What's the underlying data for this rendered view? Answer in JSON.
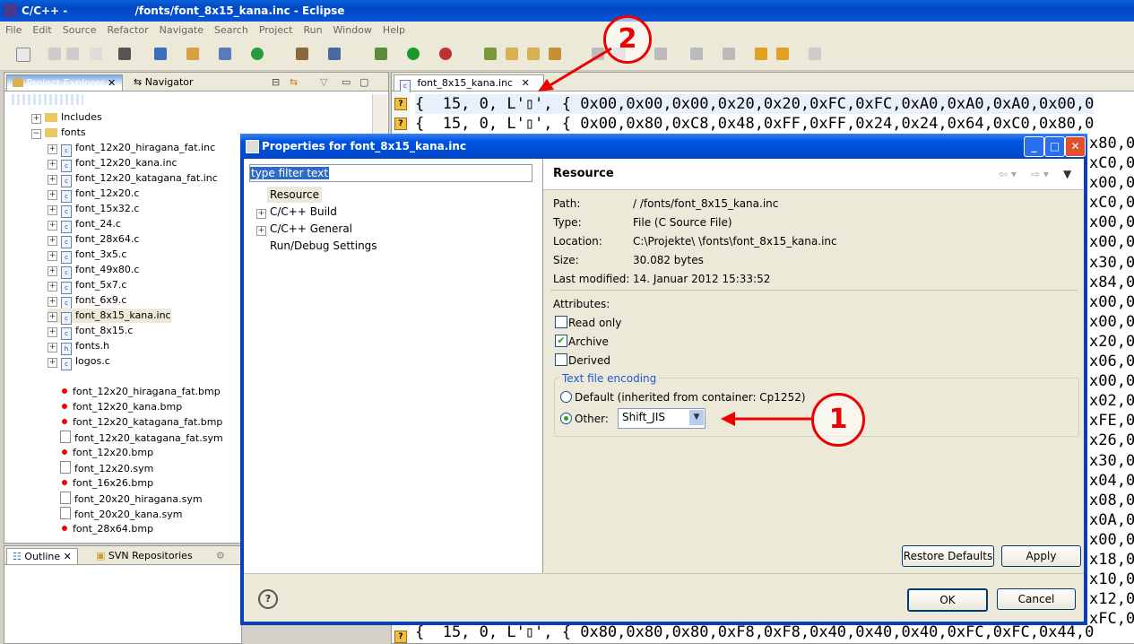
{
  "window": {
    "title": "C/C++ -                  /fonts/font_8x15_kana.inc - Eclipse"
  },
  "menu": [
    "File",
    "Edit",
    "Source",
    "Refactor",
    "Navigate",
    "Search",
    "Project",
    "Run",
    "Window",
    "Help"
  ],
  "explorer": {
    "tabs": [
      "Project Explorer",
      "Navigator"
    ],
    "items": [
      {
        "label": "Includes",
        "icon": "includes-icon"
      },
      {
        "label": "fonts",
        "icon": "folder-icon"
      },
      {
        "label": "font_12x20_hiragana_fat.inc",
        "icon": "c-file-icon"
      },
      {
        "label": "font_12x20_kana.inc",
        "icon": "c-file-icon"
      },
      {
        "label": "font_12x20_katagana_fat.inc",
        "icon": "c-file-icon"
      },
      {
        "label": "font_12x20.c",
        "icon": "c-file-icon"
      },
      {
        "label": "font_15x32.c",
        "icon": "c-file-icon"
      },
      {
        "label": "font_24.c",
        "icon": "c-file-icon"
      },
      {
        "label": "font_28x64.c",
        "icon": "c-file-icon"
      },
      {
        "label": "font_3x5.c",
        "icon": "c-file-icon"
      },
      {
        "label": "font_49x80.c",
        "icon": "c-file-icon"
      },
      {
        "label": "font_5x7.c",
        "icon": "c-file-icon"
      },
      {
        "label": "font_6x9.c",
        "icon": "c-file-icon"
      },
      {
        "label": "font_8x15_kana.inc",
        "icon": "c-file-icon"
      },
      {
        "label": "font_8x15.c",
        "icon": "c-file-icon"
      },
      {
        "label": "fonts.h",
        "icon": "h-file-icon"
      },
      {
        "label": "logos.c",
        "icon": "c-file-icon"
      },
      {
        "label": "",
        "icon": "blank"
      },
      {
        "label": "font_12x20_hiragana_fat.bmp",
        "icon": "bmp-file-icon"
      },
      {
        "label": "font_12x20_kana.bmp",
        "icon": "bmp-file-icon"
      },
      {
        "label": "font_12x20_katagana_fat.bmp",
        "icon": "bmp-file-icon"
      },
      {
        "label": "font_12x20_katagana_fat.sym",
        "icon": "sym-file-icon"
      },
      {
        "label": "font_12x20.bmp",
        "icon": "bmp-file-icon"
      },
      {
        "label": "font_12x20.sym",
        "icon": "sym-file-icon"
      },
      {
        "label": "font_16x26.bmp",
        "icon": "bmp-file-icon"
      },
      {
        "label": "font_20x20_hiragana.sym",
        "icon": "sym-file-icon"
      },
      {
        "label": "font_20x20_kana.sym",
        "icon": "sym-file-icon"
      },
      {
        "label": "font_28x64.bmp",
        "icon": "bmp-file-icon"
      }
    ]
  },
  "bottom_tabs": [
    "Outline",
    "SVN Repositories"
  ],
  "editor": {
    "tab": "font_8x15_kana.inc",
    "line1": "{  15, 0, L'▯', { 0x00,0x00,0x00,0x20,0x20,0xFC,0xFC,0xA0,0xA0,0xA0,0x00,0",
    "line2": "{  15, 0, L'▯', { 0x00,0x80,0xC8,0x48,0xFF,0xFF,0x24,0x24,0x64,0xC0,0x80,0",
    "line_last": "{  15, 0, L'▯', { 0x80,0x80,0x80,0xF8,0xF8,0x40,0x40,0x40,0xFC,0xFC,0x44,0",
    "right_column": [
      "x80,0",
      "xC0,0",
      "x00,0",
      "xC0,0",
      "x00,0",
      "x00,0",
      "x30,0",
      "x84,0",
      "x00,0",
      "x00,0",
      "x20,0",
      "x06,0",
      "x00,0",
      "x02,0",
      "xFE,0",
      "x26,0",
      "x30,0",
      "x04,0",
      "x08,0",
      "x0A,0",
      "x00,0",
      "x18,0",
      "x10,0",
      "x12,0",
      "xFC,0"
    ]
  },
  "dialog": {
    "title": "Properties for font_8x15_kana.inc",
    "filter_placeholder": "type filter text",
    "tree": [
      "Resource",
      "C/C++ Build",
      "C/C++ General",
      "Run/Debug Settings"
    ],
    "section_title": "Resource",
    "path_label": "Path:",
    "path_value": "/                    /fonts/font_8x15_kana.inc",
    "type_label": "Type:",
    "type_value": "File  (C Source File)",
    "location_label": "Location:",
    "location_value": "C:\\Projekte\\                         \\fonts\\font_8x15_kana.inc",
    "size_label": "Size:",
    "size_value": "30.082  bytes",
    "modified_label": "Last modified:",
    "modified_value": "14. Januar 2012 15:33:52",
    "attributes_label": "Attributes:",
    "read_only": "Read only",
    "read_only_checked": false,
    "archive": "Archive",
    "archive_checked": true,
    "derived": "Derived",
    "derived_checked": false,
    "encoding_group": "Text file encoding",
    "default_option": "Default (inherited from container: Cp1252)",
    "other_option": "Other:",
    "encoding_value": "Shift_JIS",
    "restore_defaults": "Restore Defaults",
    "apply": "Apply",
    "ok": "OK",
    "cancel": "Cancel",
    "help_icon": "help-icon"
  },
  "annotations": {
    "one": "1",
    "two": "2"
  }
}
